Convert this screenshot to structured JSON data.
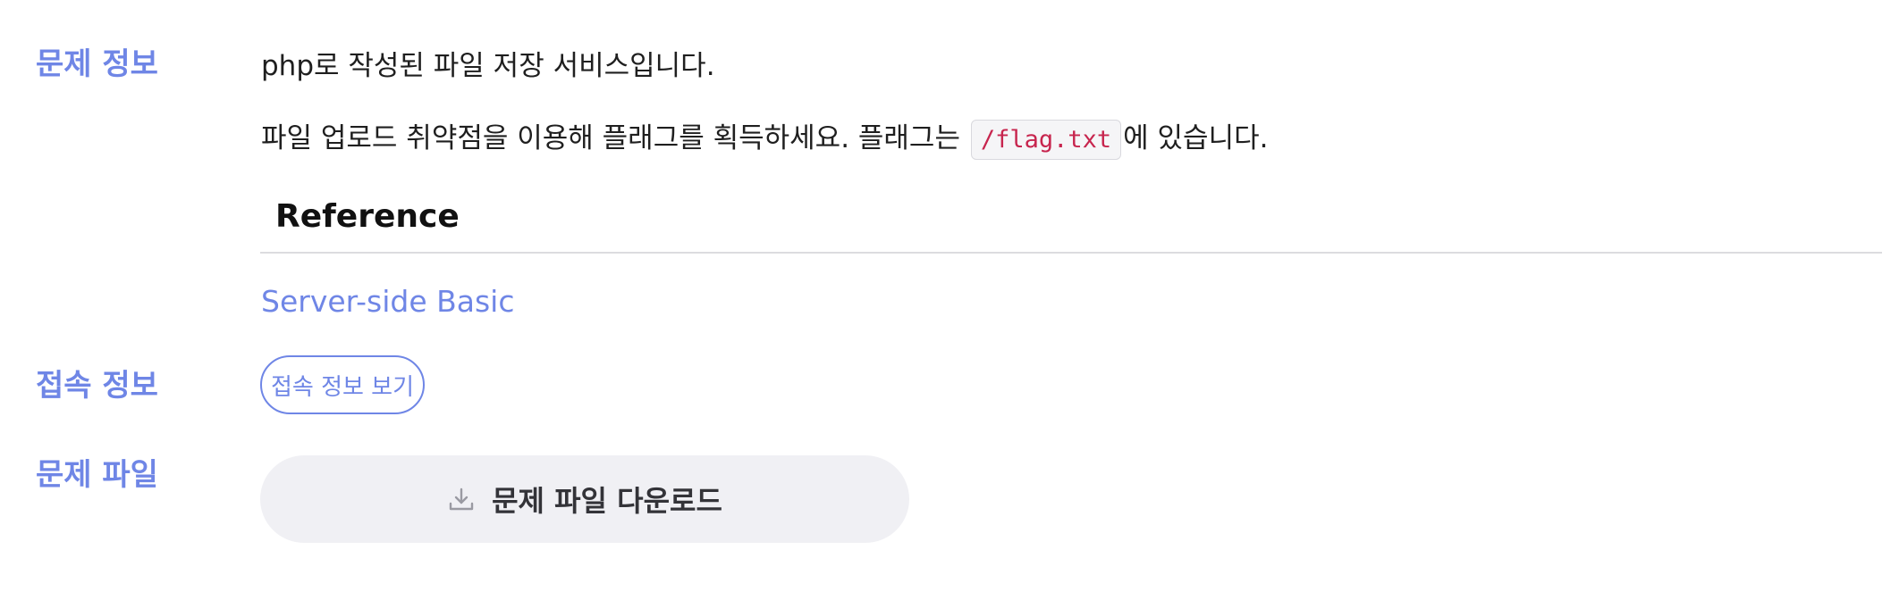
{
  "sections": {
    "problem_info_label": "문제 정보",
    "access_info_label": "접속 정보",
    "problem_file_label": "문제 파일"
  },
  "description": {
    "line1": "php로 작성된 파일 저장 서비스입니다.",
    "line2_before": "파일 업로드 취약점을 이용해 플래그를 획득하세요. 플래그는 ",
    "line2_code": "/flag.txt",
    "line2_after": "에 있습니다."
  },
  "reference": {
    "heading": "Reference",
    "link_text": "Server-side Basic"
  },
  "access": {
    "button_label": "접속 정보 보기"
  },
  "file": {
    "download_label": "문제 파일 다운로드",
    "download_icon": "download-icon"
  },
  "colors": {
    "accent": "#6f86e6",
    "code_text": "#c7254e",
    "download_bg": "#f0f0f4"
  }
}
